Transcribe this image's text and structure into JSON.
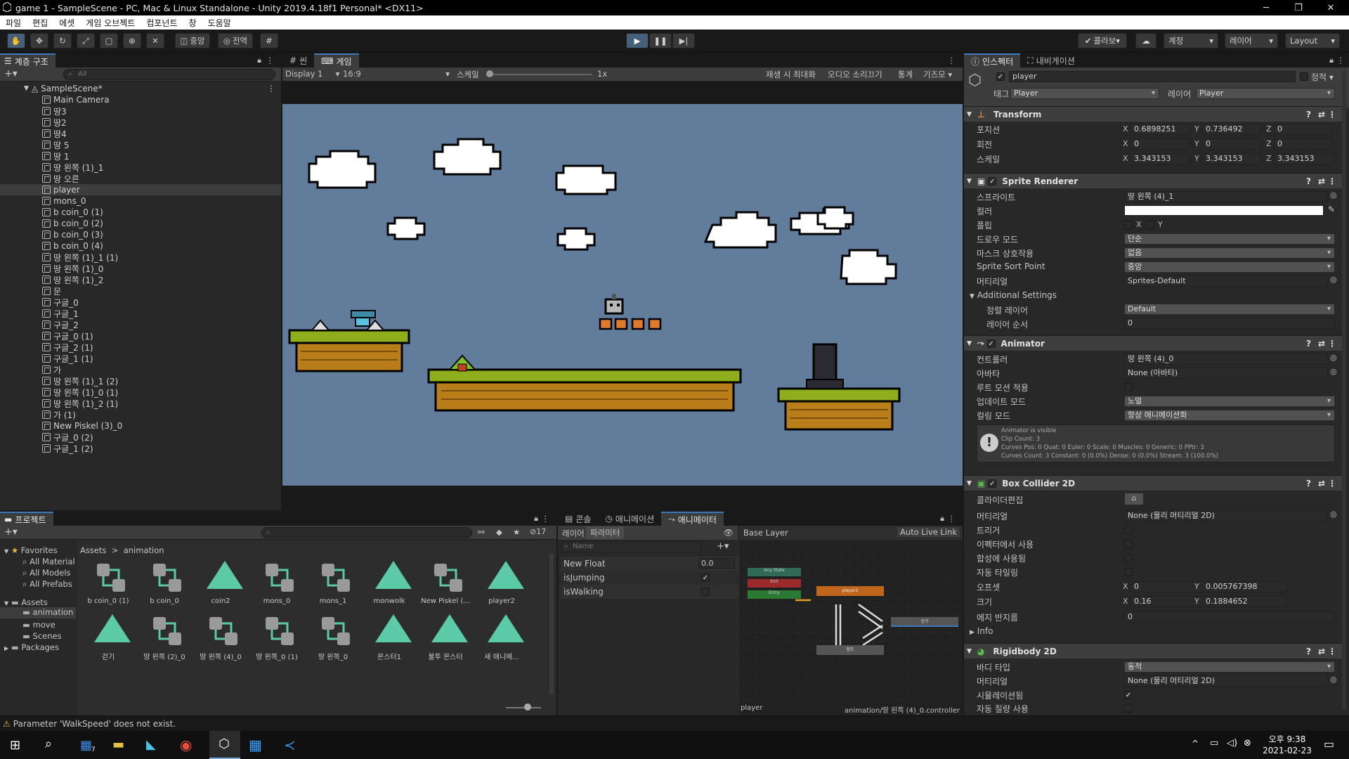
{
  "window": {
    "title": "game 1 - SampleScene - PC, Mac & Linux Standalone - Unity 2019.4.18f1 Personal* <DX11>",
    "minimize": "─",
    "maximize": "❐",
    "close": "✕"
  },
  "menu": [
    "파일",
    "편집",
    "에셋",
    "게임 오브젝트",
    "컴포넌트",
    "창",
    "도움말"
  ],
  "toolbar": {
    "pivot": "중앙",
    "global": "전역",
    "collab": "콜라보",
    "account": "계정",
    "layers": "레이어",
    "layout": "Layout"
  },
  "hierarchy": {
    "tab": "계층 구조",
    "search_placeholder": "All",
    "scene": "SampleScene*",
    "items": [
      "Main Camera",
      "땅3",
      "땅2",
      "땅4",
      "땅 5",
      "땅 1",
      "땅 왼쪽 (1)_1",
      "땅 오른",
      "player",
      "mons_0",
      "b coin_0 (1)",
      "b coin_0 (2)",
      "b coin_0 (3)",
      "b coin_0 (4)",
      "땅 왼쪽 (1)_1 (1)",
      "땅 왼쪽 (1)_0",
      "땅 왼쪽 (1)_2",
      "문",
      "구글_0",
      "구글_1",
      "구글_2",
      "구글_0 (1)",
      "구글_2 (1)",
      "구글_1 (1)",
      "가",
      "땅 왼쪽 (1)_1 (2)",
      "땅 왼쪽 (1)_0 (1)",
      "땅 왼쪽 (1)_2 (1)",
      "가 (1)",
      "New Piskel (3)_0",
      "구글_0 (2)",
      "구글_1 (2)"
    ],
    "selected": "player"
  },
  "game_view": {
    "tab_scene": "씬",
    "tab_game": "게임",
    "display": "Display 1",
    "aspect": "16:9",
    "scale_label": "스케일",
    "scale_value": "1x",
    "maximize_on_play": "재생 시 최대화",
    "mute_audio": "오디오 소리끄기",
    "stats": "통계",
    "gizmos": "기즈모"
  },
  "inspector": {
    "tab": "인스펙터",
    "tab_nav": "내비게이션",
    "object_name": "player",
    "static_label": "정적",
    "tag_label": "태그",
    "tag": "Player",
    "layer_label": "레이어",
    "layer": "Player",
    "transform": {
      "title": "Transform",
      "position_label": "포지션",
      "pos": [
        "0.6898251",
        "0.736492",
        "0"
      ],
      "rotation_label": "회전",
      "rot": [
        "0",
        "0",
        "0"
      ],
      "scale_label": "스케일",
      "scale": [
        "3.343153",
        "3.343153",
        "3.343153"
      ]
    },
    "sprite_renderer": {
      "title": "Sprite Renderer",
      "sprite_label": "스프라이트",
      "sprite": "땅 왼쪽 (4)_1",
      "color_label": "컬러",
      "flip_label": "플립",
      "draw_mode_label": "드로우 모드",
      "draw_mode": "단순",
      "mask_label": "마스크 상호작용",
      "mask": "없음",
      "sort_point_label": "Sprite Sort Point",
      "sort_point": "중앙",
      "material_label": "머티리얼",
      "material": "Sprites-Default",
      "additional": "Additional Settings",
      "sorting_layer_label": "정렬 레이어",
      "sorting_layer": "Default",
      "order_label": "레이어 순서",
      "order": "0"
    },
    "animator": {
      "title": "Animator",
      "controller_label": "컨트롤러",
      "controller": "땅 왼쪽 (4)_0",
      "avatar_label": "아바타",
      "avatar": "None (아바타)",
      "root_motion_label": "루트 모션 적용",
      "update_label": "업데이트 모드",
      "update": "노멀",
      "culling_label": "컬링 모드",
      "culling": "항상 애니메이션화",
      "info": [
        "Animator is visible",
        "Clip Count: 3",
        "Curves Pos: 0 Quat: 0 Euler: 0 Scale: 0 Muscles: 0 Generic: 0 PPtr: 3",
        "Curves Count: 3 Constant: 0 (0.0%) Dense: 0 (0.0%) Stream: 3 (100.0%)"
      ]
    },
    "box_collider": {
      "title": "Box Collider 2D",
      "edit_label": "콜라이더편집",
      "material_label": "머티리얼",
      "material": "None (물리 머티리얼 2D)",
      "trigger_label": "트리거",
      "effector_label": "이펙터에서 사용",
      "composite_label": "합성에 사용됨",
      "tiling_label": "자동 타일링",
      "offset_label": "오프셋",
      "offset": [
        "0",
        "0.005767398"
      ],
      "size_label": "크기",
      "size": [
        "0.16",
        "0.1884652"
      ],
      "edge_label": "에지 반지름",
      "edge": "0",
      "info_label": "Info"
    },
    "rigidbody": {
      "title": "Rigidbody 2D",
      "body_type_label": "바디 타입",
      "body_type": "동적",
      "material_label": "머티리얼",
      "material": "None (물리 머티리얼 2D)",
      "simulated_label": "시뮬레이션됨",
      "auto_mass_label": "자동 질량 사용"
    }
  },
  "project": {
    "tab": "프로젝트",
    "favorites": "Favorites",
    "fav_items": [
      "All Material",
      "All Models",
      "All Prefabs"
    ],
    "assets": "Assets",
    "folders": [
      "animation",
      "move",
      "Scenes"
    ],
    "packages": "Packages",
    "breadcrumb": [
      "Assets",
      "animation"
    ],
    "count": "17",
    "assets_row1": [
      {
        "name": "b coin_0 (1)",
        "type": "controller"
      },
      {
        "name": "b coin_0",
        "type": "controller"
      },
      {
        "name": "coin2",
        "type": "clip"
      },
      {
        "name": "mons_0",
        "type": "controller"
      },
      {
        "name": "mons_1",
        "type": "controller"
      },
      {
        "name": "monwolk",
        "type": "clip"
      },
      {
        "name": "New Piskel (...",
        "type": "controller"
      },
      {
        "name": "player2",
        "type": "clip"
      }
    ],
    "assets_row2": [
      {
        "name": "걷기",
        "type": "clip"
      },
      {
        "name": "땅 왼쪽 (2)_0",
        "type": "controller"
      },
      {
        "name": "땅 왼쪽 (4)_0",
        "type": "controller"
      },
      {
        "name": "땅 왼쪽_0 (1)",
        "type": "controller"
      },
      {
        "name": "땅 왼쪽_0",
        "type": "controller"
      },
      {
        "name": "몬스터1",
        "type": "clip"
      },
      {
        "name": "불투 몬스터",
        "type": "clip"
      },
      {
        "name": "새 애니메...",
        "type": "clip"
      }
    ]
  },
  "animator_window": {
    "tab_console": "콘솔",
    "tab_animation": "애니메이션",
    "tab_animator": "애니메이터",
    "sub_layers": "레이어",
    "sub_params": "파라미터",
    "base_layer": "Base Layer",
    "auto_live": "Auto Live Link",
    "search_placeholder": "Name",
    "params": [
      {
        "name": "New Float",
        "value": "0.0"
      },
      {
        "name": "isJumping",
        "value": "✓"
      },
      {
        "name": "isWalking",
        "value": ""
      }
    ],
    "nodes": {
      "any": "Any State",
      "exit": "Exit",
      "entry": "Entry",
      "player": "player2",
      "walk": "걷기",
      "jump": "점프"
    },
    "footer_left": "player",
    "footer_right": "animation/땅 왼쪽 (4)_0.controller"
  },
  "status": "Parameter 'WalkSpeed' does not exist.",
  "taskbar": {
    "time": "오후 9:38",
    "date": "2021-02-23",
    "badge": "7"
  },
  "colors": {
    "sky": "#627c9c",
    "accent": "#3a79bb",
    "grass": "#8fae1c",
    "dirt": "#b97e1a"
  }
}
